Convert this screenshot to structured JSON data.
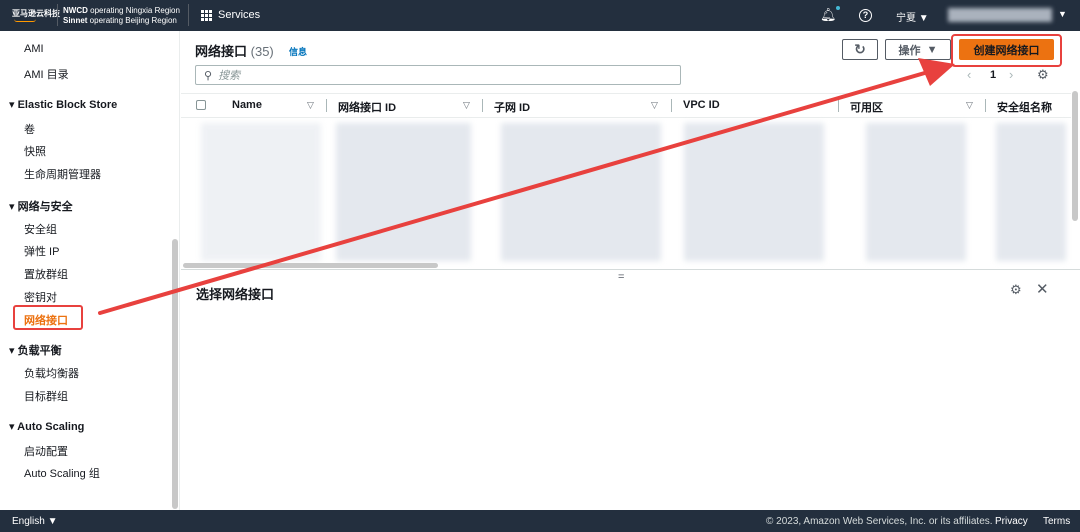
{
  "header": {
    "logo": "亚马逊云科技",
    "region_line1_bold": "NWCD",
    "region_line1": " operating Ningxia Region",
    "region_line2_bold": "Sinnet",
    "region_line2": " operating Beijing Region",
    "services": "Services",
    "region_select": "宁夏"
  },
  "sidebar": {
    "items": [
      "AMI",
      "AMI 目录"
    ],
    "sections": [
      {
        "title": "Elastic Block Store",
        "items": [
          "卷",
          "快照",
          "生命周期管理器"
        ]
      },
      {
        "title": "网络与安全",
        "items": [
          "安全组",
          "弹性 IP",
          "置放群组",
          "密钥对",
          "网络接口"
        ]
      },
      {
        "title": "负载平衡",
        "items": [
          "负载均衡器",
          "目标群组"
        ]
      },
      {
        "title": "Auto Scaling",
        "items": [
          "启动配置",
          "Auto Scaling 组"
        ]
      }
    ]
  },
  "main": {
    "title": "网络接口",
    "count": "(35)",
    "info": "信息",
    "actions": "操作",
    "create": "创建网络接口",
    "search_placeholder": "搜索",
    "page": "1",
    "columns": [
      "Name",
      "网络接口 ID",
      "子网 ID",
      "VPC ID",
      "可用区",
      "安全组名称"
    ],
    "detail_title": "选择网络接口"
  },
  "footer": {
    "language": "English",
    "copyright": "© 2023, Amazon Web Services, Inc. or its affiliates.",
    "privacy": "Privacy",
    "terms": "Terms"
  },
  "colors": {
    "accent": "#ec7211",
    "annotation": "#e8413e",
    "header": "#232f3e"
  }
}
